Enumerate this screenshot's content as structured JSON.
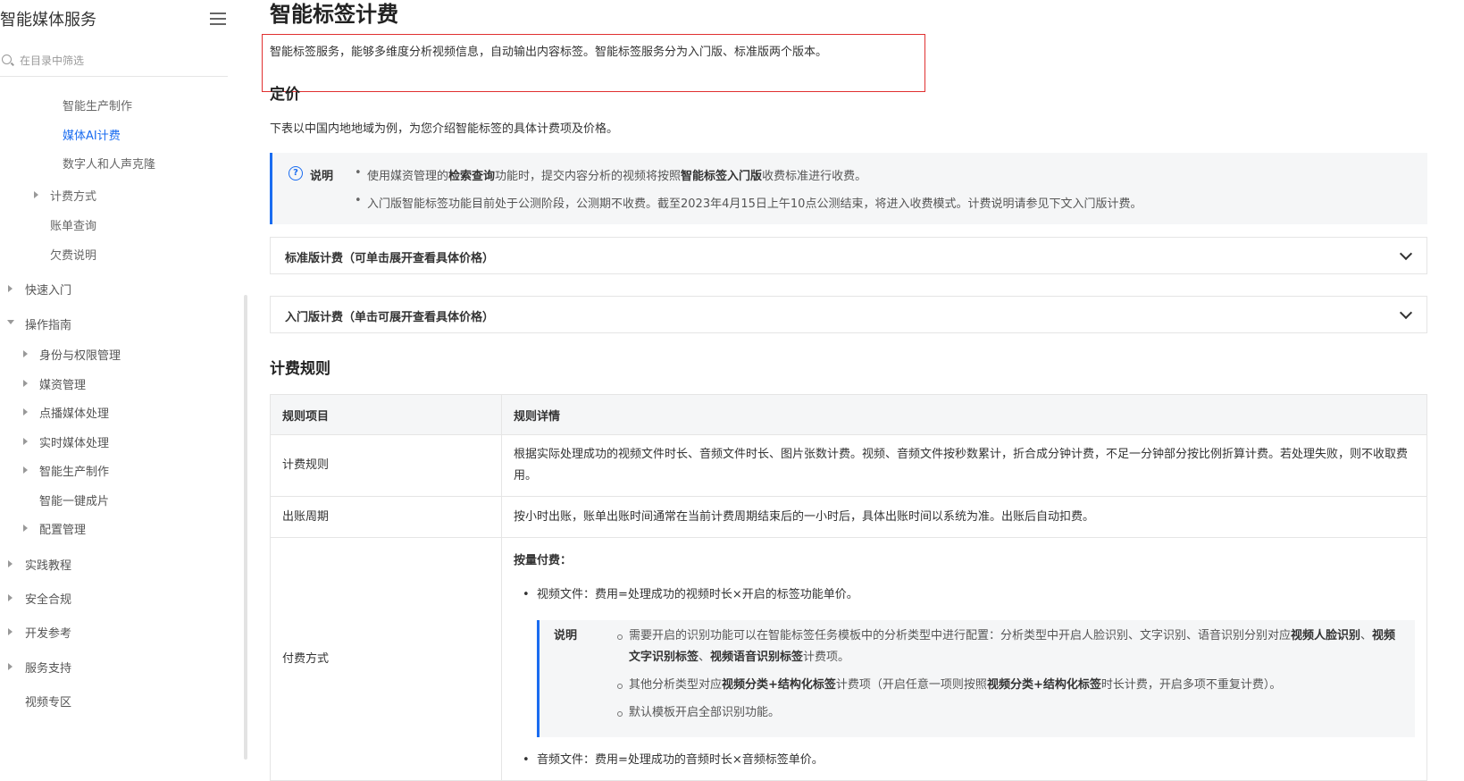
{
  "sidebar": {
    "title": "智能媒体服务",
    "search_placeholder": "在目录中筛选",
    "items": [
      {
        "label": "智能生产制作"
      },
      {
        "label": "媒体AI计费"
      },
      {
        "label": "数字人和人声克隆"
      },
      {
        "label": "计费方式"
      },
      {
        "label": "账单查询"
      },
      {
        "label": "欠费说明"
      },
      {
        "label": "快速入门"
      },
      {
        "label": "操作指南"
      },
      {
        "label": "身份与权限管理"
      },
      {
        "label": "媒资管理"
      },
      {
        "label": "点播媒体处理"
      },
      {
        "label": "实时媒体处理"
      },
      {
        "label": "智能生产制作"
      },
      {
        "label": "智能一键成片"
      },
      {
        "label": "配置管理"
      },
      {
        "label": "实践教程"
      },
      {
        "label": "安全合规"
      },
      {
        "label": "开发参考"
      },
      {
        "label": "服务支持"
      },
      {
        "label": "视频专区"
      }
    ]
  },
  "main": {
    "title": "智能标签计费",
    "intro": "智能标签服务，能够多维度分析视频信息，自动输出内容标签。智能标签服务分为入门版、标准版两个版本。",
    "pricing_heading": "定价",
    "pricing_desc": "下表以中国内地地域为例，为您介绍智能标签的具体计费项及价格。",
    "note": {
      "icon": "question-circle-icon",
      "label": "说明",
      "item1_a": "使用媒资管理的",
      "item1_b": "检索查询",
      "item1_c": "功能时，提交内容分析的视频将按照",
      "item1_d": "智能标签入门版",
      "item1_e": "收费标准进行收费。",
      "item2": "入门版智能标签功能目前处于公测阶段，公测期不收费。截至2023年4月15日上午10点公测结束，将进入收费模式。计费说明请参见下文入门版计费。"
    },
    "accordions": [
      {
        "title": "标准版计费（可单击展开查看具体价格）"
      },
      {
        "title": "入门版计费（单击可展开查看具体价格）"
      }
    ],
    "rules_heading": "计费规则",
    "table": {
      "headers": [
        "规则项目",
        "规则详情"
      ],
      "row1": {
        "name": "计费规则",
        "detail": "根据实际处理成功的视频文件时长、音频文件时长、图片张数计费。视频、音频文件按秒数累计，折合成分钟计费，不足一分钟部分按比例折算计费。若处理失败，则不收取费用。"
      },
      "row2": {
        "name": "出账周期",
        "detail": "按小时出账，账单出账时间通常在当前计费周期结束后的一小时后，具体出账时间以系统为准。出账后自动扣费。"
      },
      "row3": {
        "name": "付费方式",
        "heading": "按量付费：",
        "video": "视频文件：费用=处理成功的视频时长×开启的标签功能单价。",
        "inner_label": "说明",
        "inner1_a": "需要开启的识别功能可以在智能标签任务模板中的分析类型中进行配置：分析类型中开启人脸识别、文字识别、语音识别分别对应",
        "inner1_b": "视频人脸识别",
        "inner1_c": "、",
        "inner1_d": "视频文字识别标签",
        "inner1_e": "、",
        "inner1_f": "视频语音识别标签",
        "inner1_g": "计费项。",
        "inner2_a": "其他分析类型对应",
        "inner2_b": "视频分类+结构化标签",
        "inner2_c": "计费项（开启任意一项则按照",
        "inner2_d": "视频分类+结构化标签",
        "inner2_e": "时长计费，开启多项不重复计费）。",
        "inner3": "默认模板开启全部识别功能。",
        "audio": "音频文件：费用=处理成功的音频时长×音频标签单价。"
      }
    }
  },
  "colors": {
    "accent": "#1a6cf0",
    "highlight_box": "#e03030",
    "note_bg": "#f5f6f7"
  }
}
